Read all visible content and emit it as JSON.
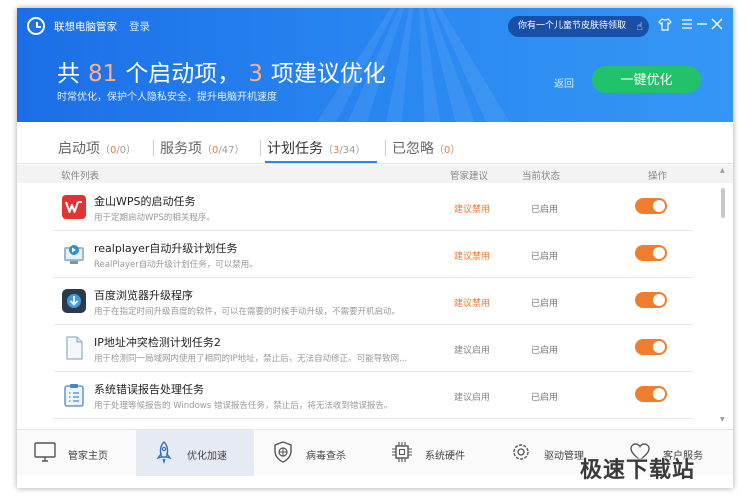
{
  "app": {
    "title": "联想电脑管家",
    "login": "登录"
  },
  "promo": {
    "text": "你有一个儿童节皮肤待领取",
    "icon": "pointer-hand-icon"
  },
  "window_controls": [
    "shirt-icon",
    "menu-icon",
    "minimize-icon",
    "close-icon"
  ],
  "header": {
    "prefix": "共",
    "startup_count": "81",
    "middle": "个启动项，",
    "suggest_count": "3",
    "suffix": "项建议优化",
    "subtitle": "时常优化，保护个人隐私安全，提升电脑开机速度",
    "back_label": "返回",
    "optimize_label": "一键优化"
  },
  "tabs": [
    {
      "label": "启动项",
      "open": "（",
      "done": "0",
      "total": "/0）"
    },
    {
      "label": "服务项",
      "open": "（",
      "done": "0",
      "total": "/47）"
    },
    {
      "label": "计划任务",
      "open": "（",
      "done": "3",
      "total": "/34）",
      "active": true
    },
    {
      "label": "已忽略",
      "open": "（",
      "done": "0",
      "total": "）"
    }
  ],
  "columns": {
    "name": "软件列表",
    "suggest": "管家建议",
    "status": "当前状态",
    "action": "操作"
  },
  "rows": [
    {
      "name": "金山WPS的启动任务",
      "desc": "用于定期启动WPS的相关程序。",
      "suggest": "建议禁用",
      "status": "已启用",
      "icon": "wps-icon",
      "enabled": 1
    },
    {
      "name": "realplayer自动升级计划任务",
      "desc": "RealPlayer自动升级计划任务，可以禁用。",
      "suggest": "建议禁用",
      "status": "已启用",
      "icon": "realplayer-icon",
      "enabled": 1
    },
    {
      "name": "百度浏览器升级程序",
      "desc": "用于在指定时间升级百度的软件，可以在需要的时候手动升级，不需要开机启动。",
      "suggest": "建议禁用",
      "status": "已启用",
      "icon": "baidu-browser-icon",
      "enabled": 1
    },
    {
      "name": "IP地址冲突检测计划任务2",
      "desc": "用于检测同一局域网内使用了相同的IP地址，禁止后，无法自动修正。可能导致网...",
      "suggest": "建议启用",
      "status": "已启用",
      "icon": "document-icon",
      "enabled": 1
    },
    {
      "name": "系统错误报告处理任务",
      "desc": "用于处理等候报告的 Windows 错误报告任务，禁止后，将无法收到错误报告。",
      "suggest": "建议启用",
      "status": "已启用",
      "icon": "clipboard-list-icon",
      "enabled": 1
    }
  ],
  "colors": {
    "suggest_disable": "#f07a33",
    "suggest_enable": "#888888",
    "toggle_on": "#f07c2e",
    "accent": "#2c85ee",
    "optimize_button": "#21c36a"
  },
  "nav": [
    {
      "label": "管家主页",
      "icon": "monitor-icon"
    },
    {
      "label": "优化加速",
      "icon": "rocket-icon",
      "active": true
    },
    {
      "label": "病毒查杀",
      "icon": "shield-icon"
    },
    {
      "label": "系统硬件",
      "icon": "chip-icon"
    },
    {
      "label": "驱动管理",
      "icon": "gear-icon"
    },
    {
      "label": "客户服务",
      "icon": "heart-headset-icon"
    }
  ],
  "watermark": "极速下载站"
}
